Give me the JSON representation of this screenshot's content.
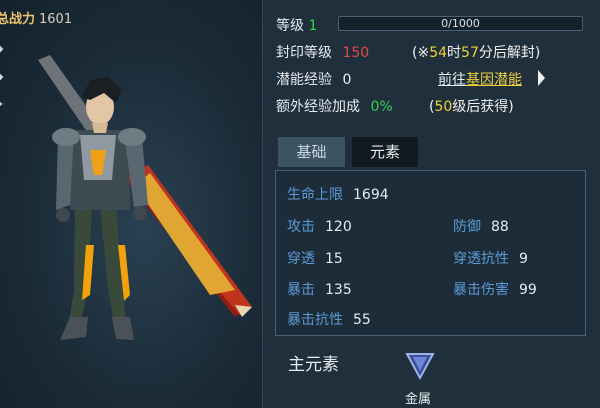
{
  "character": {
    "power_label": "总战力",
    "power_value": "1601"
  },
  "level": {
    "label": "等级",
    "value": "1",
    "xp_text": "0/1000",
    "xp_fraction": 0.0
  },
  "seal": {
    "label": "封印等级",
    "value": "150",
    "note_prefix": "(※",
    "hours": "54",
    "hours_unit": "时",
    "minutes": "57",
    "minutes_unit": "分后解封)"
  },
  "potential": {
    "label": "潜能经验",
    "value": "0",
    "link_prefix": "前往",
    "link_text": "基因潜能"
  },
  "bonus": {
    "label": "额外经验加成",
    "value": "0%",
    "note_prefix": "(",
    "unlock_level": "50",
    "note_suffix": "级后获得)"
  },
  "tabs": {
    "basic": "基础",
    "element": "元素"
  },
  "stats": {
    "hp_label": "生命上限",
    "hp": "1694",
    "atk_label": "攻击",
    "atk": "120",
    "def_label": "防御",
    "def": "88",
    "pen_label": "穿透",
    "pen": "15",
    "penres_label": "穿透抗性",
    "penres": "9",
    "crit_label": "暴击",
    "crit": "135",
    "critdmg_label": "暴击伤害",
    "critdmg": "99",
    "critres_label": "暴击抗性",
    "critres": "55"
  },
  "main_element": {
    "label": "主元素",
    "name": "金属",
    "icon": "metal-element-icon"
  },
  "colors": {
    "green": "#35d04a",
    "red": "#e04a4a",
    "yellow": "#f1d13b",
    "stat_key": "#5b9ad6"
  }
}
